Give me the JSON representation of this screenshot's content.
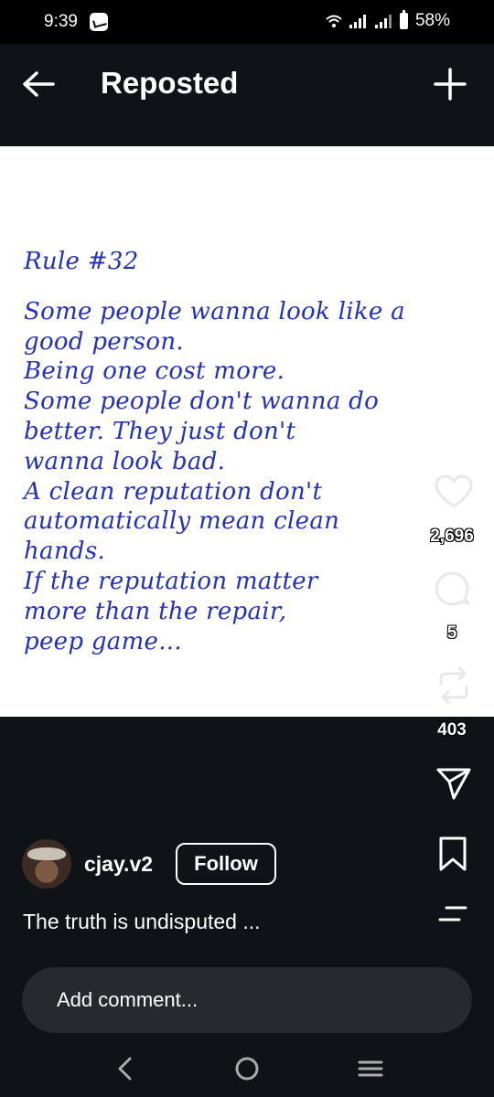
{
  "status_bar": {
    "time": "9:39",
    "battery": "58%"
  },
  "header": {
    "title": "Reposted"
  },
  "post": {
    "lines": [
      "Rule #32",
      "Some people wanna look like a",
      "good person.",
      "Being one cost more.",
      "Some people don't wanna do",
      "better. They just don't",
      "wanna look bad.",
      "A clean reputation don't",
      "automatically mean clean",
      "hands.",
      "If the reputation matter",
      "more than the repair,",
      "peep game..."
    ],
    "text_color": "#2530b8"
  },
  "actions": {
    "likes": "2,696",
    "comments": "5",
    "reposts": "403"
  },
  "author": {
    "username": "cjay.v2",
    "follow_label": "Follow"
  },
  "caption": "The truth is undisputed ...",
  "comment": {
    "placeholder": "Add comment..."
  },
  "icons": {
    "back": "arrow-left-icon",
    "add": "plus-icon",
    "like": "heart-icon",
    "comment": "comment-bubble-icon",
    "repost": "repost-icon",
    "share": "send-icon",
    "save": "bookmark-icon",
    "more": "more-lines-icon"
  }
}
